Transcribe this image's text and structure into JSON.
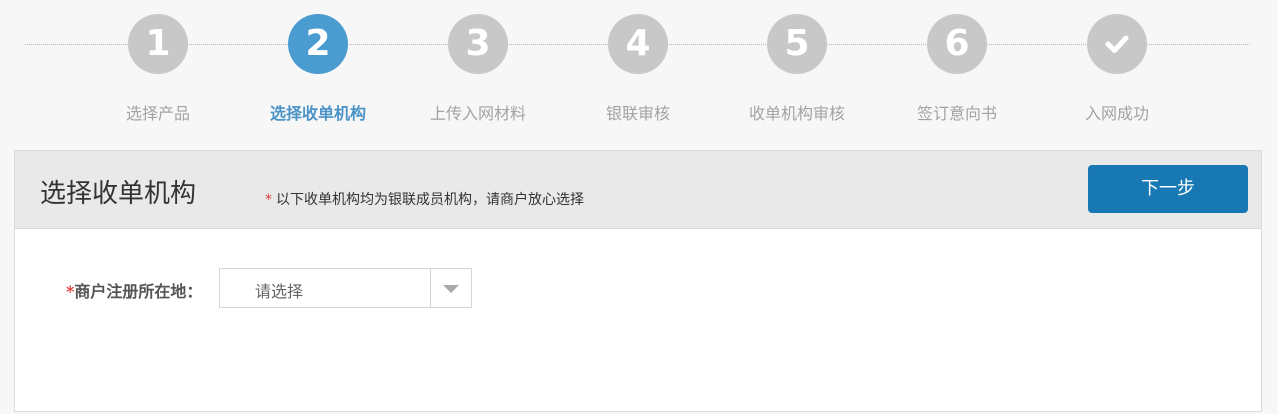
{
  "stepper": {
    "active_index": 1,
    "steps": [
      {
        "number": "1",
        "label": "选择产品"
      },
      {
        "number": "2",
        "label": "选择收单机构"
      },
      {
        "number": "3",
        "label": "上传入网材料"
      },
      {
        "number": "4",
        "label": "银联审核"
      },
      {
        "number": "5",
        "label": "收单机构审核"
      },
      {
        "number": "6",
        "label": "签订意向书"
      },
      {
        "number": "",
        "label": "入网成功",
        "icon": "checkmark-icon"
      }
    ]
  },
  "panel": {
    "title": "选择收单机构",
    "note_star": "*",
    "note": "以下收单机构均为银联成员机构，请商户放心选择",
    "next_label": "下一步"
  },
  "form": {
    "required_mark": "*",
    "region_label": "商户注册所在地：",
    "region_value": "请选择",
    "region_arrow_icon": "caret-down-icon"
  },
  "colors": {
    "active_step": "#4a9bd0",
    "inactive_step": "#c8c8c8",
    "primary_button": "#1878b4",
    "required": "#e03c3c"
  }
}
